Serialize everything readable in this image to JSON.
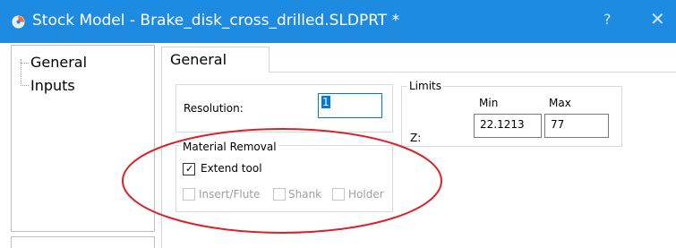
{
  "window": {
    "title": "Stock Model - Brake_disk_cross_drilled.SLDPRT *",
    "help_label": "?",
    "close_label": "✕",
    "titlebar_color": "#1e8be0"
  },
  "tree": {
    "items": [
      {
        "label": "General"
      },
      {
        "label": "Inputs"
      }
    ]
  },
  "tab": {
    "label": "General"
  },
  "resolution": {
    "label": "Resolution:",
    "value": "1"
  },
  "limits": {
    "title": "Limits",
    "min_label": "Min",
    "max_label": "Max",
    "z_label": "Z:",
    "z_min": "22.1213",
    "z_max": "77"
  },
  "material_removal": {
    "title": "Material Removal",
    "extend_tool": {
      "label": "Extend tool",
      "checked": true,
      "check_glyph": "✓"
    },
    "insert_flute": {
      "label": "Insert/Flute",
      "checked": false,
      "enabled": false
    },
    "shank": {
      "label": "Shank",
      "checked": false,
      "enabled": false
    },
    "holder": {
      "label": "Holder",
      "checked": false,
      "enabled": false
    }
  },
  "annotation": {
    "color": "#d9232a",
    "shape": "ellipse"
  }
}
